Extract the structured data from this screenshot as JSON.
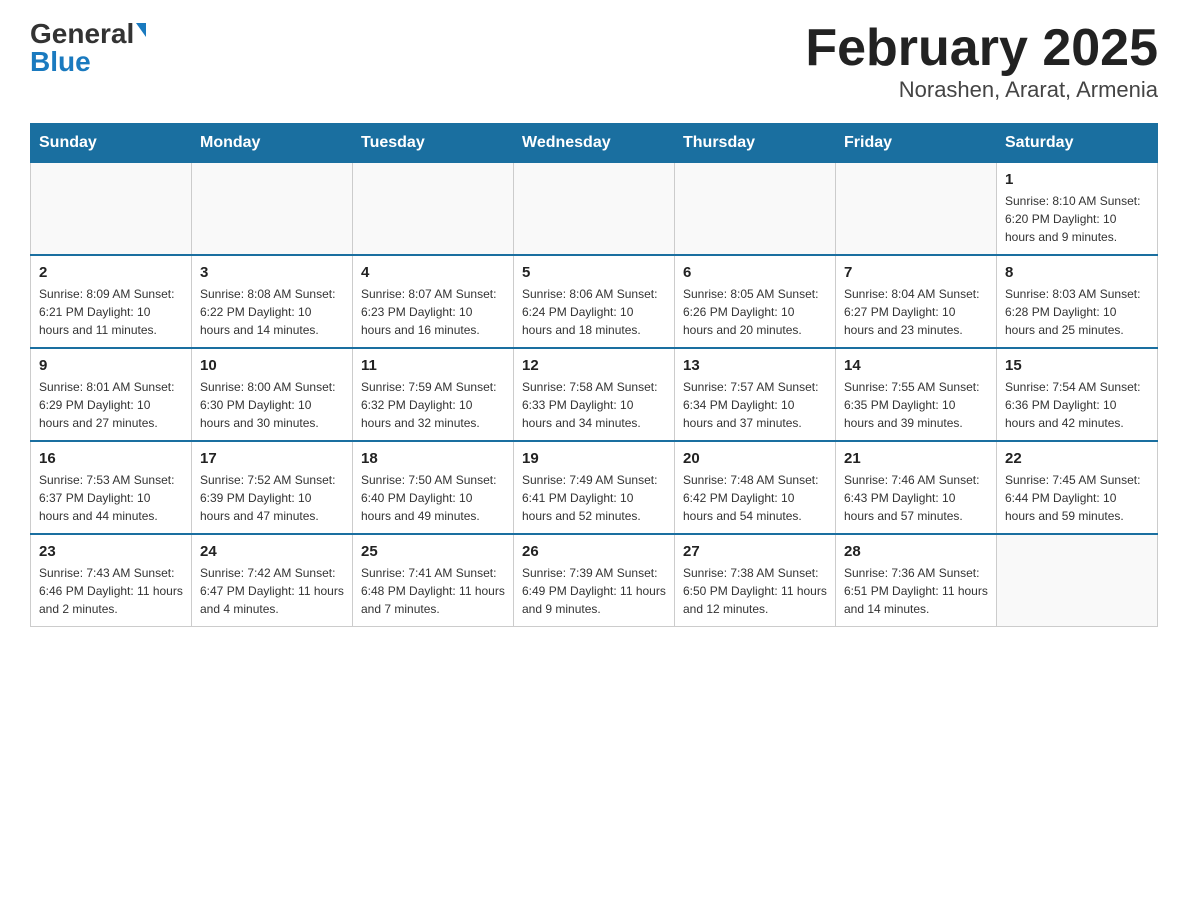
{
  "header": {
    "logo_general": "General",
    "logo_blue": "Blue",
    "title": "February 2025",
    "subtitle": "Norashen, Ararat, Armenia"
  },
  "weekdays": [
    "Sunday",
    "Monday",
    "Tuesday",
    "Wednesday",
    "Thursday",
    "Friday",
    "Saturday"
  ],
  "weeks": [
    [
      {
        "day": "",
        "info": ""
      },
      {
        "day": "",
        "info": ""
      },
      {
        "day": "",
        "info": ""
      },
      {
        "day": "",
        "info": ""
      },
      {
        "day": "",
        "info": ""
      },
      {
        "day": "",
        "info": ""
      },
      {
        "day": "1",
        "info": "Sunrise: 8:10 AM\nSunset: 6:20 PM\nDaylight: 10 hours and 9 minutes."
      }
    ],
    [
      {
        "day": "2",
        "info": "Sunrise: 8:09 AM\nSunset: 6:21 PM\nDaylight: 10 hours and 11 minutes."
      },
      {
        "day": "3",
        "info": "Sunrise: 8:08 AM\nSunset: 6:22 PM\nDaylight: 10 hours and 14 minutes."
      },
      {
        "day": "4",
        "info": "Sunrise: 8:07 AM\nSunset: 6:23 PM\nDaylight: 10 hours and 16 minutes."
      },
      {
        "day": "5",
        "info": "Sunrise: 8:06 AM\nSunset: 6:24 PM\nDaylight: 10 hours and 18 minutes."
      },
      {
        "day": "6",
        "info": "Sunrise: 8:05 AM\nSunset: 6:26 PM\nDaylight: 10 hours and 20 minutes."
      },
      {
        "day": "7",
        "info": "Sunrise: 8:04 AM\nSunset: 6:27 PM\nDaylight: 10 hours and 23 minutes."
      },
      {
        "day": "8",
        "info": "Sunrise: 8:03 AM\nSunset: 6:28 PM\nDaylight: 10 hours and 25 minutes."
      }
    ],
    [
      {
        "day": "9",
        "info": "Sunrise: 8:01 AM\nSunset: 6:29 PM\nDaylight: 10 hours and 27 minutes."
      },
      {
        "day": "10",
        "info": "Sunrise: 8:00 AM\nSunset: 6:30 PM\nDaylight: 10 hours and 30 minutes."
      },
      {
        "day": "11",
        "info": "Sunrise: 7:59 AM\nSunset: 6:32 PM\nDaylight: 10 hours and 32 minutes."
      },
      {
        "day": "12",
        "info": "Sunrise: 7:58 AM\nSunset: 6:33 PM\nDaylight: 10 hours and 34 minutes."
      },
      {
        "day": "13",
        "info": "Sunrise: 7:57 AM\nSunset: 6:34 PM\nDaylight: 10 hours and 37 minutes."
      },
      {
        "day": "14",
        "info": "Sunrise: 7:55 AM\nSunset: 6:35 PM\nDaylight: 10 hours and 39 minutes."
      },
      {
        "day": "15",
        "info": "Sunrise: 7:54 AM\nSunset: 6:36 PM\nDaylight: 10 hours and 42 minutes."
      }
    ],
    [
      {
        "day": "16",
        "info": "Sunrise: 7:53 AM\nSunset: 6:37 PM\nDaylight: 10 hours and 44 minutes."
      },
      {
        "day": "17",
        "info": "Sunrise: 7:52 AM\nSunset: 6:39 PM\nDaylight: 10 hours and 47 minutes."
      },
      {
        "day": "18",
        "info": "Sunrise: 7:50 AM\nSunset: 6:40 PM\nDaylight: 10 hours and 49 minutes."
      },
      {
        "day": "19",
        "info": "Sunrise: 7:49 AM\nSunset: 6:41 PM\nDaylight: 10 hours and 52 minutes."
      },
      {
        "day": "20",
        "info": "Sunrise: 7:48 AM\nSunset: 6:42 PM\nDaylight: 10 hours and 54 minutes."
      },
      {
        "day": "21",
        "info": "Sunrise: 7:46 AM\nSunset: 6:43 PM\nDaylight: 10 hours and 57 minutes."
      },
      {
        "day": "22",
        "info": "Sunrise: 7:45 AM\nSunset: 6:44 PM\nDaylight: 10 hours and 59 minutes."
      }
    ],
    [
      {
        "day": "23",
        "info": "Sunrise: 7:43 AM\nSunset: 6:46 PM\nDaylight: 11 hours and 2 minutes."
      },
      {
        "day": "24",
        "info": "Sunrise: 7:42 AM\nSunset: 6:47 PM\nDaylight: 11 hours and 4 minutes."
      },
      {
        "day": "25",
        "info": "Sunrise: 7:41 AM\nSunset: 6:48 PM\nDaylight: 11 hours and 7 minutes."
      },
      {
        "day": "26",
        "info": "Sunrise: 7:39 AM\nSunset: 6:49 PM\nDaylight: 11 hours and 9 minutes."
      },
      {
        "day": "27",
        "info": "Sunrise: 7:38 AM\nSunset: 6:50 PM\nDaylight: 11 hours and 12 minutes."
      },
      {
        "day": "28",
        "info": "Sunrise: 7:36 AM\nSunset: 6:51 PM\nDaylight: 11 hours and 14 minutes."
      },
      {
        "day": "",
        "info": ""
      }
    ]
  ]
}
